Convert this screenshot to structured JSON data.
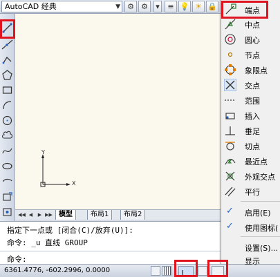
{
  "toolbar": {
    "workspace": "AutoCAD 经典"
  },
  "tabs": {
    "model": "模型",
    "layout1": "布局1",
    "layout2": "布局2"
  },
  "ucs": {
    "x_label": "X",
    "y_label": "Y"
  },
  "command": {
    "line1": "指定下一点或 [闭合(C)/放弃(U)]:",
    "line2": "命令: _u 直线 GROUP",
    "prompt": "命令:"
  },
  "status": {
    "coords": "6361.4776, -602.2996, 0.0000"
  },
  "menu": {
    "endpoint": "端点",
    "midpoint": "中点",
    "center": "圆心",
    "node": "节点",
    "quadrant": "象限点",
    "intersection": "交点",
    "extension": "范围",
    "insertion": "插入",
    "perpendicular": "垂足",
    "tangent": "切点",
    "nearest": "最近点",
    "apparent": "外观交点",
    "parallel": "平行",
    "enable": "启用(E)",
    "use_icons": "使用图标(",
    "settings": "设置(S)...",
    "display": "显示"
  },
  "colors": {
    "highlight": "#e0141e",
    "canvas": "#fbf8ee",
    "check": "#1c5fd4"
  }
}
